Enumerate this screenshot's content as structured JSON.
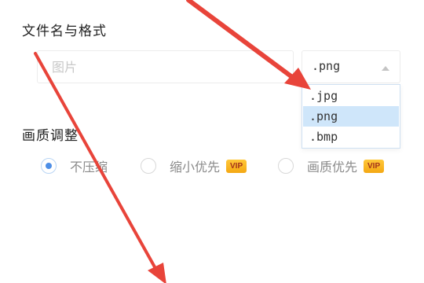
{
  "filename_section": {
    "title": "文件名与格式",
    "input_placeholder": "图片"
  },
  "format_select": {
    "selected": ".png",
    "options": [
      ".jpg",
      ".png",
      ".bmp"
    ],
    "highlighted_option": ".png"
  },
  "quality_section": {
    "title": "画质调整",
    "options": [
      {
        "label": "不压缩",
        "checked": true,
        "vip": false
      },
      {
        "label": "缩小优先",
        "checked": false,
        "vip": true
      },
      {
        "label": "画质优先",
        "checked": false,
        "vip": true
      }
    ],
    "vip_label": "VIP"
  },
  "colors": {
    "accent_blue": "#4d8ee6",
    "dropdown_highlight": "#cfe6fa",
    "vip_gold": "#f4a712",
    "annotation_arrow": "#e8443a"
  },
  "icons": {
    "select_caret": "caret-up-icon",
    "radio": "radio-circle-icon"
  }
}
